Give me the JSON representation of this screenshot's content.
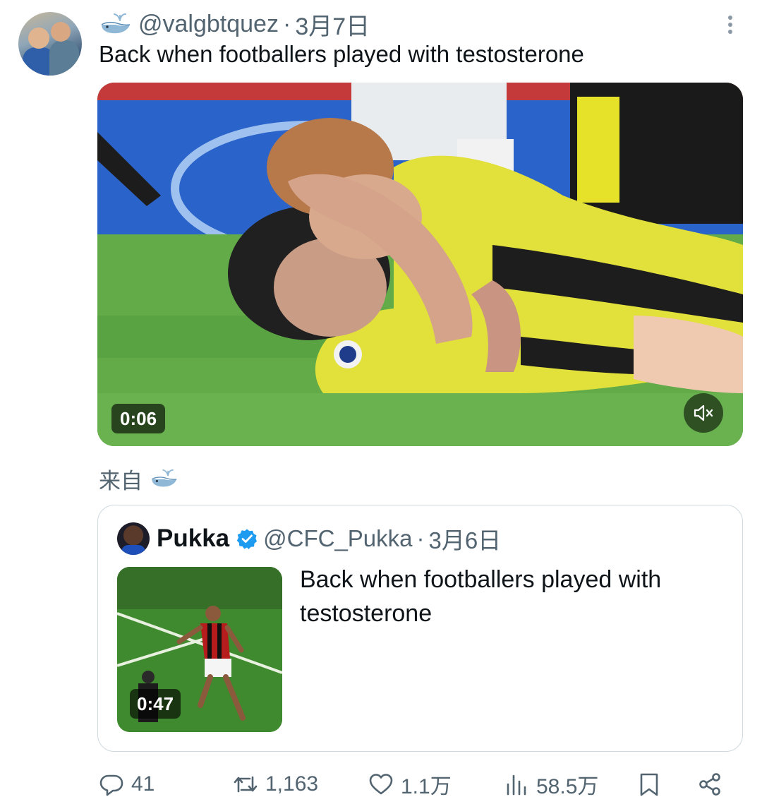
{
  "tweet": {
    "handle": "@valgbtquez",
    "separator": "·",
    "date": "3月7日",
    "text": "Back when footballers played with testosterone",
    "media": {
      "duration": "0:06",
      "muted": true
    },
    "source_label": "来自"
  },
  "quoted_tweet": {
    "display_name": "Pukka",
    "verified": true,
    "handle": "@CFC_Pukka",
    "separator": "·",
    "date": "3月6日",
    "text": "Back when footballers played with testosterone",
    "media": {
      "duration": "0:47"
    }
  },
  "actions": {
    "replies": "41",
    "retweets": "1,163",
    "likes": "1.1万",
    "views": "58.5万"
  },
  "icons": {
    "whale": "whale-icon",
    "more": "more-vertical-icon",
    "mute": "volume-mute-icon",
    "verified": "verified-badge-icon",
    "reply": "reply-icon",
    "retweet": "retweet-icon",
    "like": "heart-icon",
    "views": "views-bar-icon",
    "bookmark": "bookmark-icon",
    "share": "share-icon"
  },
  "colors": {
    "text": "#0f1419",
    "muted": "#536471",
    "verified": "#1d9bf0",
    "border": "#cfd9de"
  }
}
